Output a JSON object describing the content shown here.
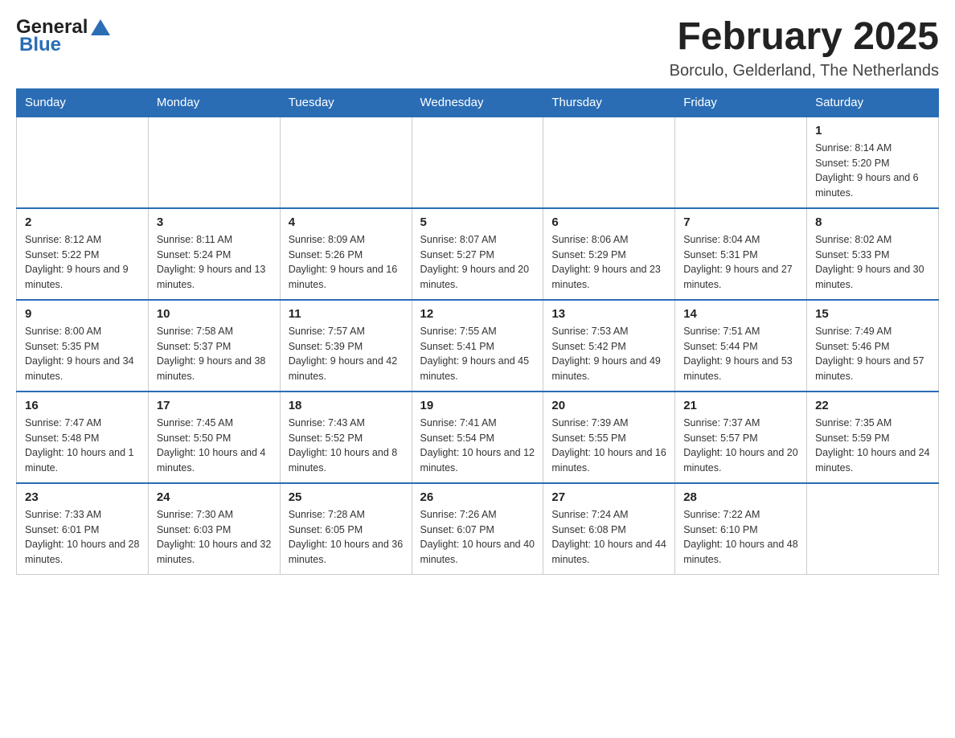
{
  "header": {
    "logo": {
      "text_general": "General",
      "text_blue": "Blue"
    },
    "title": "February 2025",
    "subtitle": "Borculo, Gelderland, The Netherlands"
  },
  "weekdays": [
    "Sunday",
    "Monday",
    "Tuesday",
    "Wednesday",
    "Thursday",
    "Friday",
    "Saturday"
  ],
  "weeks": [
    {
      "days": [
        {
          "number": "",
          "info": ""
        },
        {
          "number": "",
          "info": ""
        },
        {
          "number": "",
          "info": ""
        },
        {
          "number": "",
          "info": ""
        },
        {
          "number": "",
          "info": ""
        },
        {
          "number": "",
          "info": ""
        },
        {
          "number": "1",
          "info": "Sunrise: 8:14 AM\nSunset: 5:20 PM\nDaylight: 9 hours and 6 minutes."
        }
      ]
    },
    {
      "days": [
        {
          "number": "2",
          "info": "Sunrise: 8:12 AM\nSunset: 5:22 PM\nDaylight: 9 hours and 9 minutes."
        },
        {
          "number": "3",
          "info": "Sunrise: 8:11 AM\nSunset: 5:24 PM\nDaylight: 9 hours and 13 minutes."
        },
        {
          "number": "4",
          "info": "Sunrise: 8:09 AM\nSunset: 5:26 PM\nDaylight: 9 hours and 16 minutes."
        },
        {
          "number": "5",
          "info": "Sunrise: 8:07 AM\nSunset: 5:27 PM\nDaylight: 9 hours and 20 minutes."
        },
        {
          "number": "6",
          "info": "Sunrise: 8:06 AM\nSunset: 5:29 PM\nDaylight: 9 hours and 23 minutes."
        },
        {
          "number": "7",
          "info": "Sunrise: 8:04 AM\nSunset: 5:31 PM\nDaylight: 9 hours and 27 minutes."
        },
        {
          "number": "8",
          "info": "Sunrise: 8:02 AM\nSunset: 5:33 PM\nDaylight: 9 hours and 30 minutes."
        }
      ]
    },
    {
      "days": [
        {
          "number": "9",
          "info": "Sunrise: 8:00 AM\nSunset: 5:35 PM\nDaylight: 9 hours and 34 minutes."
        },
        {
          "number": "10",
          "info": "Sunrise: 7:58 AM\nSunset: 5:37 PM\nDaylight: 9 hours and 38 minutes."
        },
        {
          "number": "11",
          "info": "Sunrise: 7:57 AM\nSunset: 5:39 PM\nDaylight: 9 hours and 42 minutes."
        },
        {
          "number": "12",
          "info": "Sunrise: 7:55 AM\nSunset: 5:41 PM\nDaylight: 9 hours and 45 minutes."
        },
        {
          "number": "13",
          "info": "Sunrise: 7:53 AM\nSunset: 5:42 PM\nDaylight: 9 hours and 49 minutes."
        },
        {
          "number": "14",
          "info": "Sunrise: 7:51 AM\nSunset: 5:44 PM\nDaylight: 9 hours and 53 minutes."
        },
        {
          "number": "15",
          "info": "Sunrise: 7:49 AM\nSunset: 5:46 PM\nDaylight: 9 hours and 57 minutes."
        }
      ]
    },
    {
      "days": [
        {
          "number": "16",
          "info": "Sunrise: 7:47 AM\nSunset: 5:48 PM\nDaylight: 10 hours and 1 minute."
        },
        {
          "number": "17",
          "info": "Sunrise: 7:45 AM\nSunset: 5:50 PM\nDaylight: 10 hours and 4 minutes."
        },
        {
          "number": "18",
          "info": "Sunrise: 7:43 AM\nSunset: 5:52 PM\nDaylight: 10 hours and 8 minutes."
        },
        {
          "number": "19",
          "info": "Sunrise: 7:41 AM\nSunset: 5:54 PM\nDaylight: 10 hours and 12 minutes."
        },
        {
          "number": "20",
          "info": "Sunrise: 7:39 AM\nSunset: 5:55 PM\nDaylight: 10 hours and 16 minutes."
        },
        {
          "number": "21",
          "info": "Sunrise: 7:37 AM\nSunset: 5:57 PM\nDaylight: 10 hours and 20 minutes."
        },
        {
          "number": "22",
          "info": "Sunrise: 7:35 AM\nSunset: 5:59 PM\nDaylight: 10 hours and 24 minutes."
        }
      ]
    },
    {
      "days": [
        {
          "number": "23",
          "info": "Sunrise: 7:33 AM\nSunset: 6:01 PM\nDaylight: 10 hours and 28 minutes."
        },
        {
          "number": "24",
          "info": "Sunrise: 7:30 AM\nSunset: 6:03 PM\nDaylight: 10 hours and 32 minutes."
        },
        {
          "number": "25",
          "info": "Sunrise: 7:28 AM\nSunset: 6:05 PM\nDaylight: 10 hours and 36 minutes."
        },
        {
          "number": "26",
          "info": "Sunrise: 7:26 AM\nSunset: 6:07 PM\nDaylight: 10 hours and 40 minutes."
        },
        {
          "number": "27",
          "info": "Sunrise: 7:24 AM\nSunset: 6:08 PM\nDaylight: 10 hours and 44 minutes."
        },
        {
          "number": "28",
          "info": "Sunrise: 7:22 AM\nSunset: 6:10 PM\nDaylight: 10 hours and 48 minutes."
        },
        {
          "number": "",
          "info": ""
        }
      ]
    }
  ]
}
